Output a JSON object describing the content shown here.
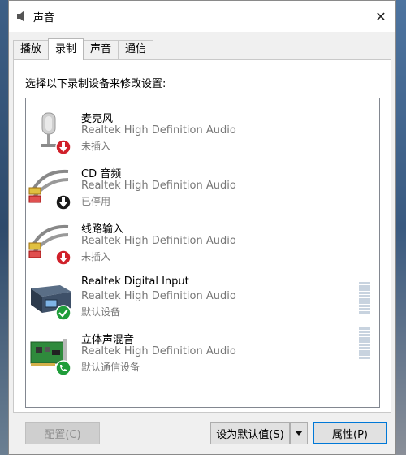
{
  "window": {
    "title": "声音",
    "close_glyph": "✕"
  },
  "tabs": [
    {
      "label": "播放",
      "active": false
    },
    {
      "label": "录制",
      "active": true
    },
    {
      "label": "声音",
      "active": false
    },
    {
      "label": "通信",
      "active": false
    }
  ],
  "prompt": "选择以下录制设备来修改设置:",
  "devices": [
    {
      "name": "麦克风",
      "driver": "Realtek High Definition Audio",
      "status": "未插入",
      "icon": "microphone-icon",
      "badge": "red-down-arrow"
    },
    {
      "name": "CD 音频",
      "driver": "Realtek High Definition Audio",
      "status": "已停用",
      "icon": "rca-cable-icon",
      "badge": "black-down-arrow"
    },
    {
      "name": "线路输入",
      "driver": "Realtek High Definition Audio",
      "status": "未插入",
      "icon": "rca-cable-icon",
      "badge": "red-down-arrow"
    },
    {
      "name": "Realtek Digital Input",
      "driver": "Realtek High Definition Audio",
      "status": "默认设备",
      "icon": "digital-input-box-icon",
      "badge": "green-checkmark"
    },
    {
      "name": "立体声混音",
      "driver": "Realtek High Definition Audio",
      "status": "默认通信设备",
      "icon": "sound-card-icon",
      "badge": "green-phone"
    }
  ],
  "buttons": {
    "configure": "配置(C)",
    "set_default": "设为默认值(S)",
    "properties": "属性(P)"
  },
  "colors": {
    "accent": "#0078d7",
    "badge_red": "#d0202a",
    "badge_green": "#1f9d3a"
  }
}
